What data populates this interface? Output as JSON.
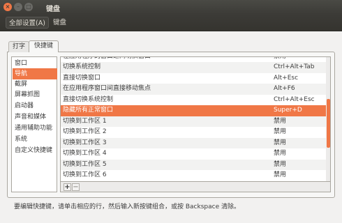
{
  "window": {
    "title": "键盘",
    "close_glyph": "×",
    "minimize_glyph": "–",
    "maximize_glyph": "□"
  },
  "toolbar": {
    "all_settings_label": "全部设置(A)",
    "breadcrumb_label": "键盘"
  },
  "tabs": [
    {
      "label": "打字"
    },
    {
      "label": "快捷键",
      "active": true
    }
  ],
  "categories": [
    {
      "label": "窗口"
    },
    {
      "label": "导航",
      "selected": true
    },
    {
      "label": "截屏"
    },
    {
      "label": "屏幕抓图"
    },
    {
      "label": "启动器"
    },
    {
      "label": "声音和媒体"
    },
    {
      "label": "通用辅助功能"
    },
    {
      "label": "系统"
    },
    {
      "label": "自定义快捷键"
    }
  ],
  "shortcuts": {
    "clipped_top": {
      "action": "在应用程序的窗口之间切换窗口",
      "accel": "禁用"
    },
    "rows": [
      {
        "action": "切换系统控制",
        "accel": "Ctrl+Alt+Tab"
      },
      {
        "action": "直接切换窗口",
        "accel": "Alt+Esc"
      },
      {
        "action": "在应用程序窗口间直接移动焦点",
        "accel": "Alt+F6"
      },
      {
        "action": "直接切换系统控制",
        "accel": "Ctrl+Alt+Esc"
      },
      {
        "action": "隐藏所有正常窗口",
        "accel": "Super+D",
        "selected": true
      },
      {
        "action": "切换到工作区 1",
        "accel": "禁用"
      },
      {
        "action": "切换到工作区 2",
        "accel": "禁用"
      },
      {
        "action": "切换到工作区 3",
        "accel": "禁用"
      },
      {
        "action": "切换到工作区 4",
        "accel": "禁用"
      },
      {
        "action": "切换到工作区 5",
        "accel": "禁用"
      },
      {
        "action": "切换到工作区 6",
        "accel": "禁用"
      }
    ]
  },
  "add_remove": {
    "add_label": "+",
    "remove_label": "−"
  },
  "hint_text": "要编辑快捷键，请单击相应的行，然后输入新按键组合，或按 Backspace 清除。",
  "colors": {
    "accent": "#f07746",
    "titlebar": "#3c3b37"
  }
}
